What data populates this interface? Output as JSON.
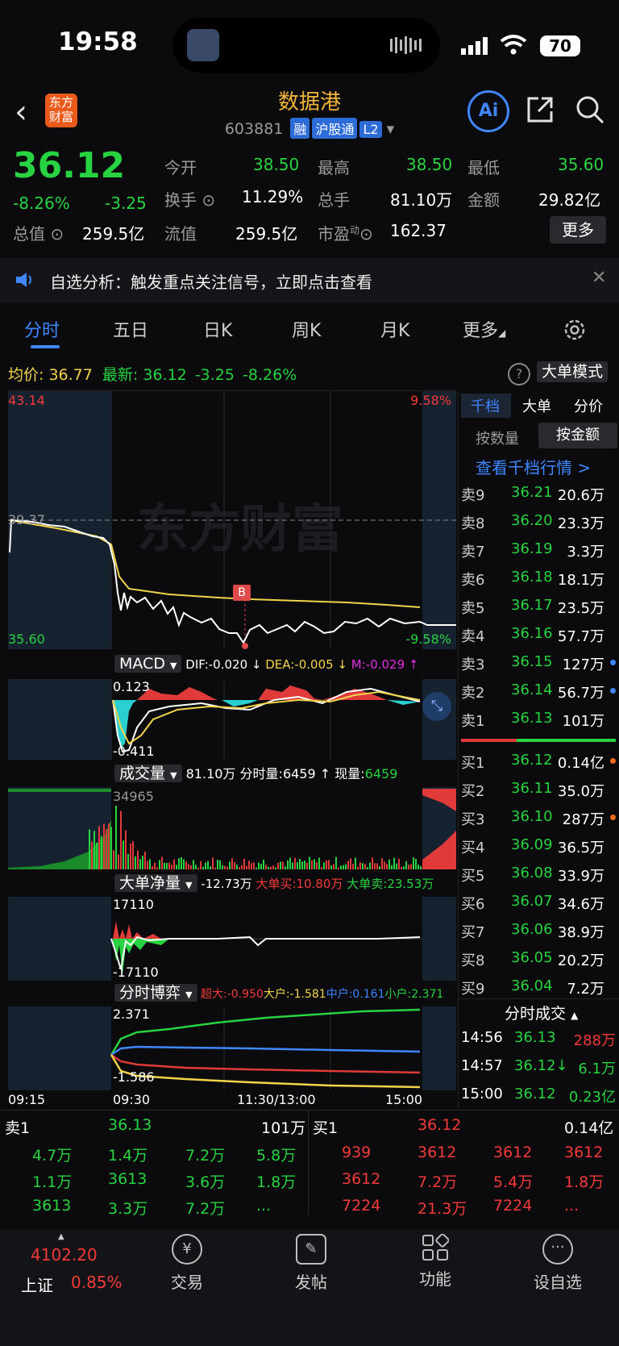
{
  "status_bar": {
    "time": "19:58",
    "battery": "70"
  },
  "header": {
    "logo_text": "东方财富",
    "stock_name": "数据港",
    "stock_code": "603881",
    "tags": [
      "融",
      "沪股通",
      "L2"
    ],
    "ai_label": "Ai"
  },
  "quote": {
    "price": "36.12",
    "change_pct": "-8.26%",
    "change_amt": "-3.25",
    "fields": [
      {
        "label": "今开",
        "value": "38.50",
        "color": "green"
      },
      {
        "label": "最高",
        "value": "38.50",
        "color": "green"
      },
      {
        "label": "最低",
        "value": "35.60",
        "color": "green"
      },
      {
        "label": "换手",
        "value": "11.29%",
        "color": "white"
      },
      {
        "label": "总手",
        "value": "81.10万",
        "color": "white"
      },
      {
        "label": "金额",
        "value": "29.82亿",
        "color": "white"
      },
      {
        "label": "总值",
        "value": "259.5亿",
        "color": "white"
      },
      {
        "label": "流值",
        "value": "259.5亿",
        "color": "white"
      },
      {
        "label": "市盈",
        "label_sup": "动",
        "value": "162.37",
        "color": "white"
      }
    ],
    "more_label": "更多"
  },
  "notice": {
    "text": "自选分析：触发重点关注信号，立即点击查看"
  },
  "tabs": [
    "分时",
    "五日",
    "日K",
    "周K",
    "月K",
    "更多"
  ],
  "active_tab": "分时",
  "summary": {
    "avg_label": "均价:",
    "avg_value": "36.77",
    "latest_label": "最新:",
    "latest_value": "36.12",
    "latest_change": "-3.25",
    "latest_pct": "-8.26%",
    "big_order_mode": "大单模式"
  },
  "price_chart": {
    "top_left": "43.14",
    "top_right": "9.58%",
    "prev_close": "39.37",
    "bottom_left": "35.60",
    "bottom_right": "-9.58%",
    "marker": "B",
    "watermark": "东方财富"
  },
  "macd": {
    "label": "MACD",
    "dif": "DIF:-0.020 ↓",
    "dea": "DEA:-0.005 ↓",
    "m": "M:-0.029 ↑",
    "top": "0.123",
    "bottom": "-0.411"
  },
  "volume": {
    "label": "成交量",
    "total": "81.10万",
    "minute_label": "分时量:",
    "minute_value": "6459 ↑",
    "current_label": "现量:",
    "current_value": "6459",
    "top": "34965"
  },
  "big_net": {
    "label": "大单净量",
    "value": "-12.73万",
    "buy_label": "大单买:",
    "buy": "10.80万",
    "sell_label": "大单卖:",
    "sell": "23.53万",
    "top": "17110",
    "bottom": "-17110"
  },
  "game": {
    "label": "分时博弈",
    "super": "超大:-0.950",
    "large": "大户:-1.581",
    "mid": "中户:0.161",
    "small": "小户:2.371",
    "top": "2.371",
    "bottom": "-1.586"
  },
  "time_axis": [
    "09:15",
    "09:30",
    "11:30/13:00",
    "15:00"
  ],
  "orderbook": {
    "tabs": [
      "千档",
      "大单",
      "分价"
    ],
    "subtabs": [
      "按数量",
      "按金额"
    ],
    "link": "查看千档行情 >",
    "asks": [
      {
        "level": "卖9",
        "price": "36.21",
        "vol": "20.6万"
      },
      {
        "level": "卖8",
        "price": "36.20",
        "vol": "23.3万"
      },
      {
        "level": "卖7",
        "price": "36.19",
        "vol": "3.3万"
      },
      {
        "level": "卖6",
        "price": "36.18",
        "vol": "18.1万"
      },
      {
        "level": "卖5",
        "price": "36.17",
        "vol": "23.5万"
      },
      {
        "level": "卖4",
        "price": "36.16",
        "vol": "57.7万"
      },
      {
        "level": "卖3",
        "price": "36.15",
        "vol": "127万"
      },
      {
        "level": "卖2",
        "price": "36.14",
        "vol": "56.7万"
      },
      {
        "level": "卖1",
        "price": "36.13",
        "vol": "101万"
      }
    ],
    "bids": [
      {
        "level": "买1",
        "price": "36.12",
        "vol": "0.14亿"
      },
      {
        "level": "买2",
        "price": "36.11",
        "vol": "35.0万"
      },
      {
        "level": "买3",
        "price": "36.10",
        "vol": "287万"
      },
      {
        "level": "买4",
        "price": "36.09",
        "vol": "36.5万"
      },
      {
        "level": "买5",
        "price": "36.08",
        "vol": "33.9万"
      },
      {
        "level": "买6",
        "price": "36.07",
        "vol": "34.6万"
      },
      {
        "level": "买7",
        "price": "36.06",
        "vol": "38.9万"
      },
      {
        "level": "买8",
        "price": "36.05",
        "vol": "20.2万"
      },
      {
        "level": "买9",
        "price": "36.04",
        "vol": "7.2万"
      }
    ],
    "trades_title": "分时成交",
    "trades": [
      {
        "time": "14:56",
        "price": "36.13",
        "vol": "288万"
      },
      {
        "time": "14:57",
        "price": "36.12↓",
        "vol": "6.1万"
      },
      {
        "time": "15:00",
        "price": "36.12",
        "vol": "0.23亿"
      }
    ]
  },
  "queue": {
    "sell_label": "卖1",
    "sell_price": "36.13",
    "sell_vol": "101万",
    "buy_label": "买1",
    "buy_price": "36.12",
    "buy_vol": "0.14亿",
    "sell_rows": [
      [
        "4.7万",
        "1.4万",
        "7.2万",
        "5.8万"
      ],
      [
        "1.1万",
        "3613",
        "3.6万",
        "1.8万"
      ],
      [
        "3613",
        "3.3万",
        "7.2万",
        "..."
      ]
    ],
    "buy_rows": [
      [
        "939",
        "3612",
        "3612",
        "3612"
      ],
      [
        "3612",
        "7.2万",
        "5.4万",
        "1.8万"
      ],
      [
        "7224",
        "21.3万",
        "7224",
        "..."
      ]
    ]
  },
  "bottom_nav": {
    "index_value": "4102.20",
    "index_name": "上证",
    "index_pct": "0.85%",
    "items": [
      "交易",
      "发帖",
      "功能",
      "设自选"
    ]
  }
}
